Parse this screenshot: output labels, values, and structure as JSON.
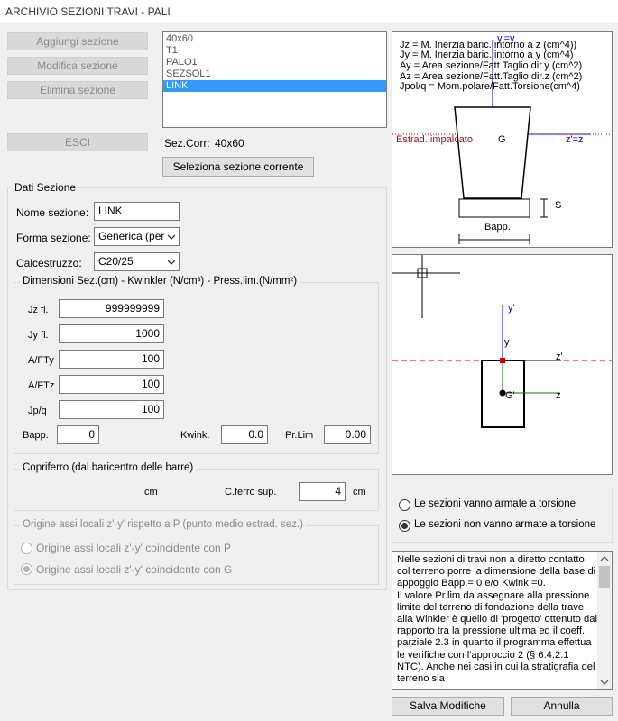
{
  "window": {
    "title": "ARCHIVIO SEZIONI TRAVI -  PALI"
  },
  "buttons": {
    "add": "Aggiungi sezione",
    "edit": "Modifica sezione",
    "delete": "Elimina sezione",
    "exit": "ESCI",
    "select_current": "Seleziona sezione corrente",
    "save": "Salva Modifiche",
    "cancel": "Annulla"
  },
  "section_list": [
    "40x60",
    "T1",
    "PALO1",
    "SEZSOL1",
    "LINK"
  ],
  "current": {
    "label": "Sez.Corr:",
    "value": "40x60"
  },
  "dati_sezione": {
    "title": "Dati Sezione",
    "name_label": "Nome sezione:",
    "name_value": "LINK",
    "shape_label": "Forma sezione:",
    "shape_value": "Generica (per",
    "concrete_label": "Calcestruzzo:",
    "concrete_value": "C20/25"
  },
  "dimensions": {
    "title": "Dimensioni Sez.(cm) - Kwinkler (N/cm³) - Press.lim.(N/mm²)",
    "jz_label": "Jz fl.",
    "jz": "999999999",
    "jy_label": "Jy fl.",
    "jy": "1000",
    "afty_label": "A/FTy",
    "afty": "100",
    "aftz_label": "A/FTz",
    "aftz": "100",
    "jpq_label": "Jp/q",
    "jpq": "100",
    "bapp_label": "Bapp.",
    "bapp": "0",
    "kwink_label": "Kwink.",
    "kwink": "0.0",
    "prlim_label": "Pr.Lim",
    "prlim": "0.00"
  },
  "copriferro": {
    "title": "Copriferro (dal baricentro delle barre)",
    "cm_label": "cm",
    "cferro_label": "C.ferro sup.",
    "cferro": "4",
    "unit": "cm"
  },
  "origine": {
    "title": "Origine assi locali z'-y' rispetto a P (punto medio estrad. sez.)",
    "opt1": "Origine assi locali z'-y' coincidente con P",
    "opt2": "Origine assi locali z'-y' coincidente con G"
  },
  "legend_diagram": {
    "line1": "Jz = M. Inerzia baric. intorno a z  (cm^4))",
    "line2": "Jy = M. Inerzia baric. intorno a y  (cm^4)",
    "line3": "Ay  = Area sezione/Fatt.Taglio dir.y (cm^2)",
    "line4": "Az  = Area sezione/Fatt.Taglio dir.z (cm^2)",
    "line5": "Jpol/q = Mom.polare/Fatt.Torsione(cm^4)",
    "yaxis": "y'=y",
    "zaxis": "z'=z",
    "g": "G",
    "estrad": "Estrad. impalcato",
    "s": "S",
    "bapp": "Bapp."
  },
  "section_diagram": {
    "yp": "y'",
    "y": "y",
    "zp": "z'",
    "z": "z",
    "g": "G'"
  },
  "torsion": {
    "opt1": "Le sezioni vanno  armate a torsione",
    "opt2": "Le sezioni non vanno armate a torsione"
  },
  "notes": "Nelle sezioni di travi non a diretto contatto col terreno porre la dimensione della base di appoggio Bapp.= 0 e/o Kwink.=0.\nIl valore Pr.lim da assegnare alla pressione limite del terreno di fondazione della trave alla Winkler è quello di 'progetto' ottenuto dal rapporto tra la pressione ultima ed il coeff. parziale 2.3 in quanto il programma effettua le verifiche con l'approccio 2 (§ 6.4.2.1 NTC). Anche nei casi in cui la stratigrafia del terreno sia",
  "colors": {
    "selection": "#3399ff",
    "blue_axis": "#0000ff",
    "red_dashed": "#cc0000",
    "green_axis": "#008000"
  }
}
